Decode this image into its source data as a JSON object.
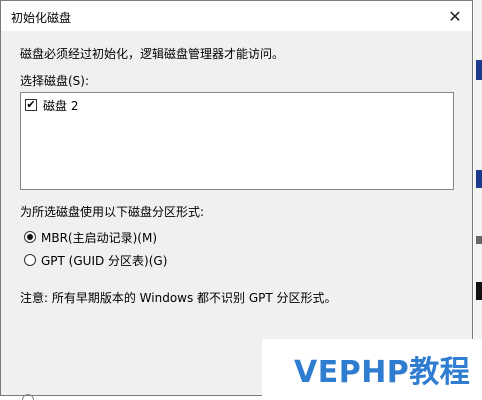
{
  "dialog": {
    "title": "初始化磁盘",
    "description": "磁盘必须经过初始化，逻辑磁盘管理器才能访问。",
    "select_label": "选择磁盘(S):",
    "disks": [
      {
        "label": "磁盘 2",
        "checked": true
      }
    ],
    "partition_label": "为所选磁盘使用以下磁盘分区形式:",
    "options": [
      {
        "label": "MBR(主启动记录)(M)",
        "selected": true
      },
      {
        "label": "GPT (GUID 分区表)(G)",
        "selected": false
      }
    ],
    "note": "注意: 所有早期版本的 Windows 都不识别 GPT 分区形式。"
  },
  "watermark": "VEPHP教程",
  "icons": {
    "close": "close-icon",
    "check": "checkmark-icon"
  },
  "colors": {
    "dialog_bg": "#f0f0f0",
    "watermark": "#2e7dd1"
  }
}
